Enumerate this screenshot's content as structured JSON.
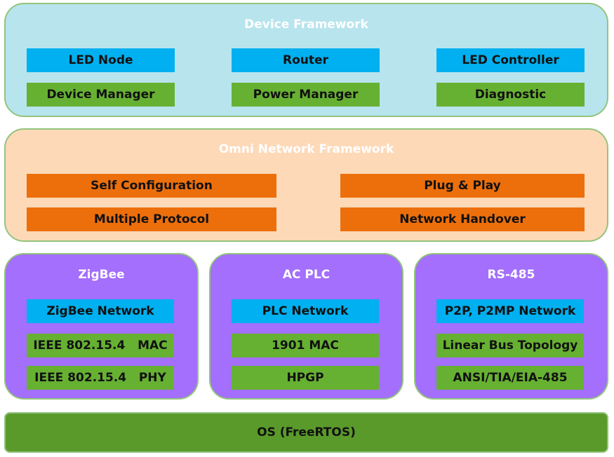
{
  "device_framework": {
    "title": "Device Framework",
    "items": [
      "LED Node",
      "Router",
      "LED Controller",
      "Device Manager",
      "Power Manager",
      "Diagnostic"
    ]
  },
  "omni_framework": {
    "title": "Omni Network Framework",
    "items": [
      "Self Configuration",
      "Plug & Play",
      "Multiple Protocol",
      "Network Handover"
    ]
  },
  "stacks": [
    {
      "title": "ZigBee",
      "items": [
        "ZigBee Network",
        "IEEE 802.15.4   MAC",
        "IEEE 802.15.4   PHY"
      ]
    },
    {
      "title": "AC PLC",
      "items": [
        "PLC Network",
        "1901 MAC",
        "HPGP"
      ]
    },
    {
      "title": "RS-485",
      "items": [
        "P2P, P2MP Network",
        "Linear Bus Topology",
        "ANSI/TIA/EIA-485"
      ]
    }
  ],
  "os": {
    "label": "OS (FreeRTOS)"
  },
  "colors": {
    "blue": "#00b0f0",
    "green": "#66b132",
    "orange": "#ec6f0c",
    "purple": "#a36ffc",
    "device_bg": "#b8e4ee",
    "omni_bg": "#fdd9b8",
    "os_bg": "#5a9a2a"
  }
}
